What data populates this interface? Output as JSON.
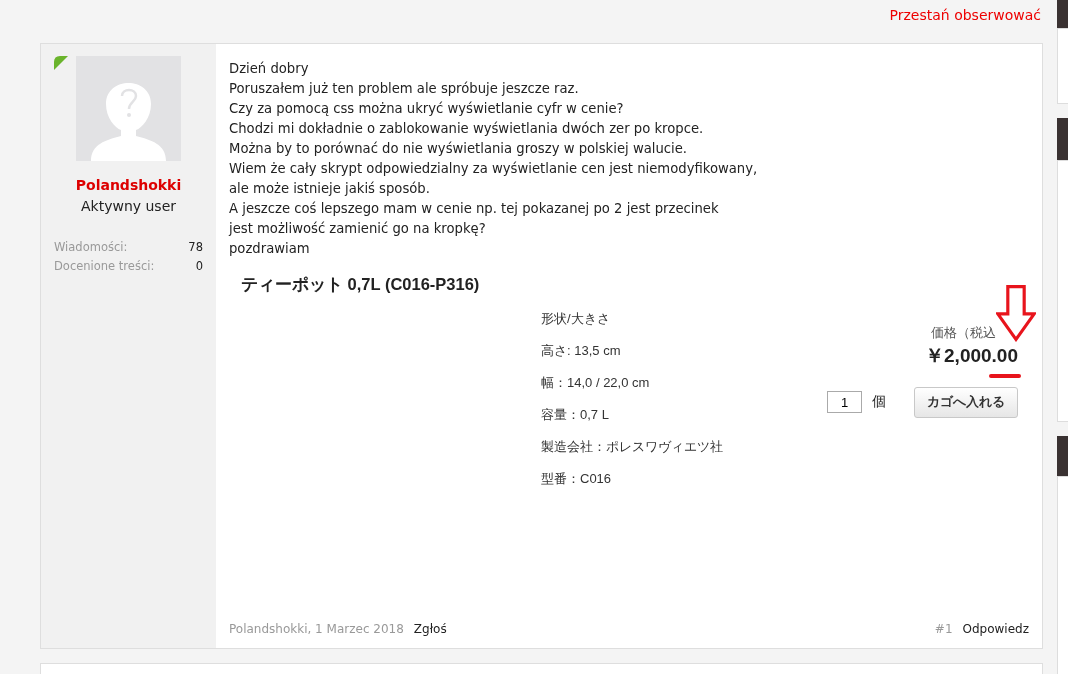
{
  "header": {
    "unfollow_link": "Przestań obserwować"
  },
  "post": {
    "author": {
      "name": "Polandshokki",
      "rank": "Aktywny user",
      "online": true,
      "stats": [
        {
          "label": "Wiadomości:",
          "value": "78"
        },
        {
          "label": "Docenione treści:",
          "value": "0"
        }
      ]
    },
    "message_lines": [
      "Dzień dobry",
      "Poruszałem już ten problem ale spróbuje jeszcze raz.",
      "Czy za pomocą css można ukryć wyświetlanie cyfr w cenie?",
      "Chodzi mi dokładnie o zablokowanie wyświetlania dwóch zer po kropce.",
      "Można by to porównać do nie wyświetlania groszy w polskiej walucie.",
      "Wiem że cały skrypt odpowiedzialny za wyświetlanie cen jest niemodyfikowany,",
      "ale może istnieje jakiś sposób.",
      "A jeszcze coś lepszego mam w cenie np. tej pokazanej po 2 jest przecinek",
      "jest możliwość zamienić go na kropkę?",
      "pozdrawiam"
    ],
    "product": {
      "title": "ティーポット 0,7L (C016-P316)",
      "specs": [
        "形状/大きさ",
        "高さ: 13,5 cm",
        "幅：14,0 / 22,0 cm",
        "容量：0,7 L",
        "製造会社：ポレスワヴィエツ社",
        "型番：C016"
      ],
      "price_label": "価格（税込",
      "price": "￥2,000.00",
      "quantity": "1",
      "unit": "個",
      "cart_button": "カゴへ入れる"
    },
    "footer": {
      "meta": "Polandshokki, 1 Marzec 2018",
      "report": "Zgłoś",
      "number": "#1",
      "reply": "Odpowiedz"
    }
  }
}
